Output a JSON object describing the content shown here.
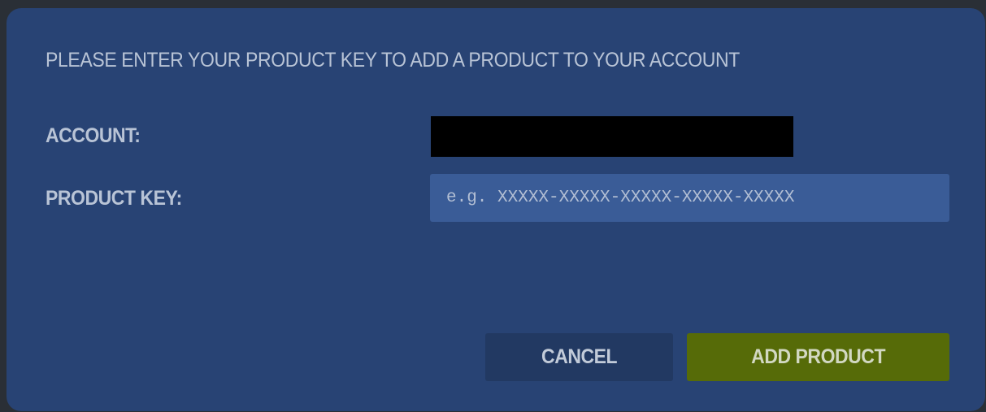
{
  "dialog": {
    "title": "PLEASE ENTER YOUR PRODUCT KEY TO ADD A PRODUCT TO YOUR ACCOUNT",
    "account_label": "ACCOUNT:",
    "account_value": "",
    "product_key_label": "PRODUCT KEY:",
    "product_key_value": "",
    "product_key_placeholder": "e.g. XXXXX-XXXXX-XXXXX-XXXXX-XXXXX",
    "cancel_label": "CANCEL",
    "add_label": "ADD PRODUCT"
  },
  "colors": {
    "dialog_background": "#284374",
    "input_background": "#3a5c97",
    "cancel_background": "#223962",
    "add_background": "#566b08",
    "label_text": "#b9c4d6"
  }
}
